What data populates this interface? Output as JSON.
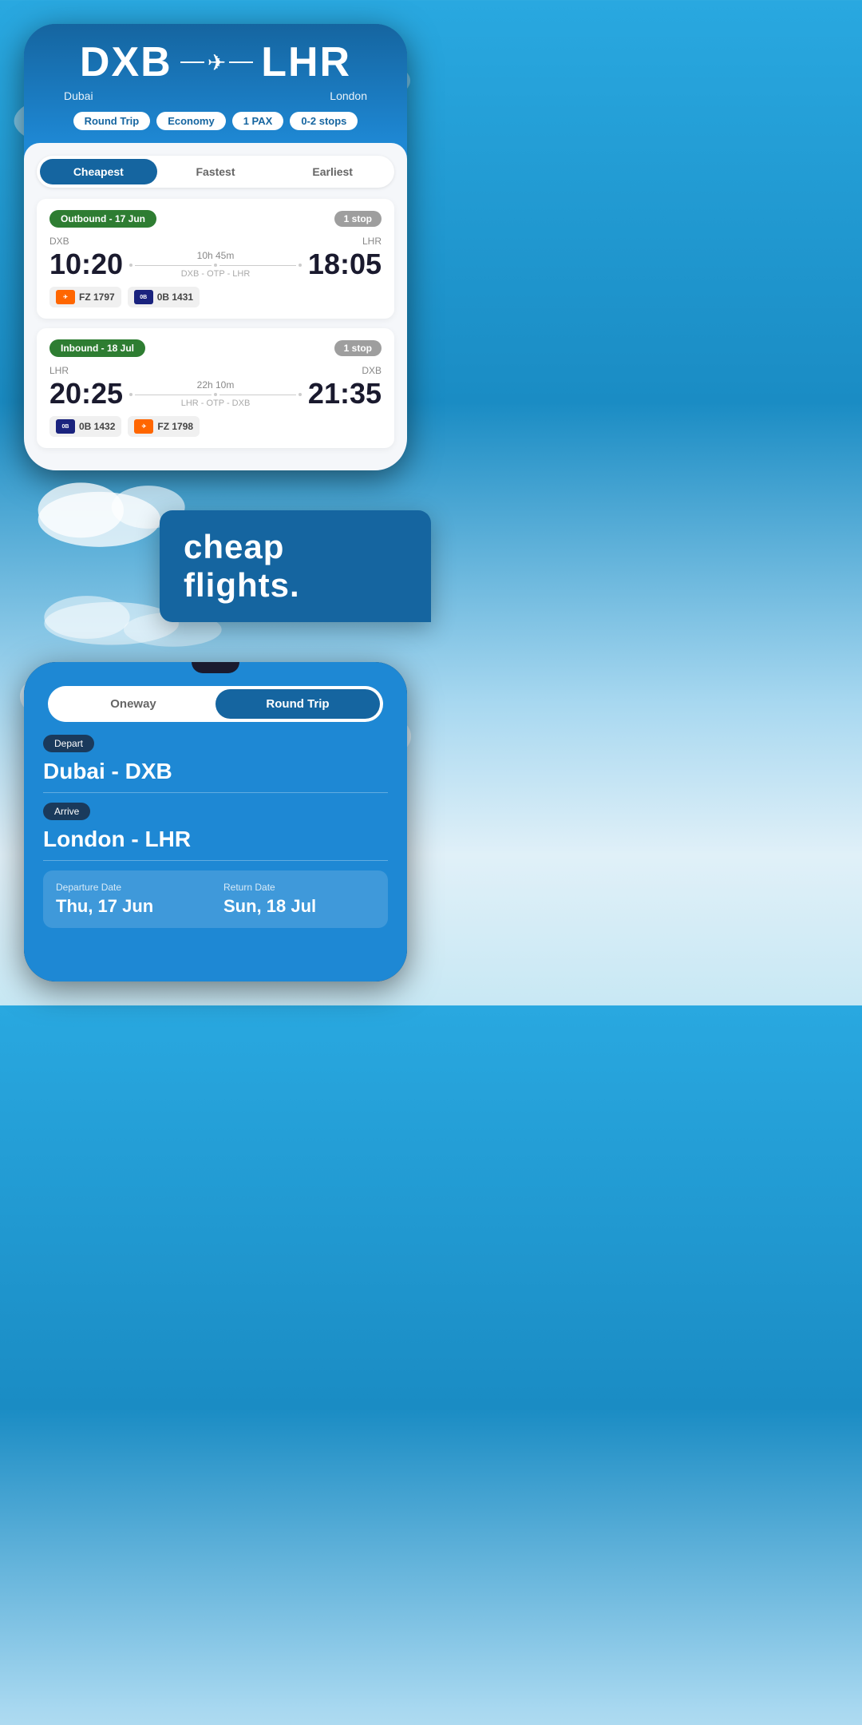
{
  "topPhone": {
    "origin": {
      "code": "DXB",
      "city": "Dubai"
    },
    "destination": {
      "code": "LHR",
      "city": "London"
    },
    "filters": {
      "tripType": "Round Trip",
      "cabinClass": "Economy",
      "passengers": "1 PAX",
      "stops": "0-2 stops"
    },
    "tabs": {
      "cheapest": "Cheapest",
      "fastest": "Fastest",
      "earliest": "Earliest",
      "activeTab": "cheapest"
    },
    "outbound": {
      "label": "Outbound - 17 Jun",
      "stopBadge": "1 stop",
      "from": "DXB",
      "to": "LHR",
      "departure": "10:20",
      "arrival": "18:05",
      "duration": "10h 45m",
      "route": "DXB - OTP - LHR",
      "airlines": [
        {
          "logo": "dubai",
          "code": "FZ 1797",
          "color": "orange"
        },
        {
          "logo": "0B",
          "code": "0B 1431",
          "color": "blue"
        }
      ]
    },
    "inbound": {
      "label": "Inbound - 18 Jul",
      "stopBadge": "1 stop",
      "from": "LHR",
      "to": "DXB",
      "departure": "20:25",
      "arrival": "21:35",
      "duration": "22h 10m",
      "route": "LHR - OTP - DXB",
      "airlines": [
        {
          "logo": "0B",
          "code": "0B 1432",
          "color": "blue"
        },
        {
          "logo": "dubai",
          "code": "FZ 1798",
          "color": "orange"
        }
      ]
    }
  },
  "promo": {
    "text": "cheap flights."
  },
  "bottomPhone": {
    "tripToggle": {
      "oneway": "Oneway",
      "roundTrip": "Round Trip",
      "active": "roundTrip"
    },
    "depart": {
      "label": "Depart",
      "value": "Dubai - DXB"
    },
    "arrive": {
      "label": "Arrive",
      "value": "London - LHR"
    },
    "dates": {
      "departureLabel": "Departure Date",
      "departureValue": "Thu, 17 Jun",
      "returnLabel": "Return Date",
      "returnValue": "Sun, 18 Jul"
    }
  }
}
